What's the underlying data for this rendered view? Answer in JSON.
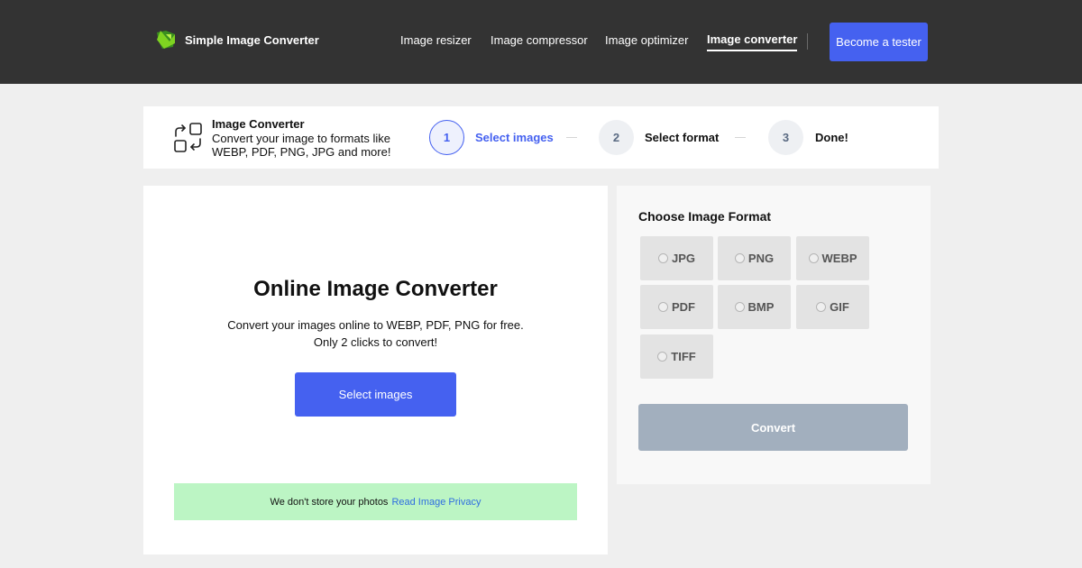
{
  "header": {
    "brand": "Simple Image Converter",
    "nav": [
      {
        "label": "Image resizer",
        "active": false
      },
      {
        "label": "Image compressor",
        "active": false
      },
      {
        "label": "Image optimizer",
        "active": false
      },
      {
        "label": "Image converter",
        "active": true
      }
    ],
    "cta_label": "Become a tester"
  },
  "steps_bar": {
    "title": "Image Converter",
    "description": "Convert your image to formats like WEBP, PDF, PNG, JPG and more!",
    "steps": [
      {
        "number": "1",
        "label": "Select images",
        "active": true
      },
      {
        "number": "2",
        "label": "Select format",
        "active": false
      },
      {
        "number": "3",
        "label": "Done!",
        "active": false
      }
    ]
  },
  "main": {
    "heading": "Online Image Converter",
    "desc_line1": "Convert your images online to WEBP, PDF, PNG for free.",
    "desc_line2": "Only 2 clicks to convert!",
    "select_button": "Select images",
    "privacy_text": "We don't store your photos",
    "privacy_link": "Read Image Privacy"
  },
  "format_panel": {
    "title": "Choose Image Format",
    "formats": [
      "JPG",
      "PNG",
      "WEBP",
      "PDF",
      "BMP",
      "GIF",
      "TIFF"
    ],
    "convert_label": "Convert"
  },
  "colors": {
    "header_bg": "#333333",
    "accent": "#4561f0",
    "privacy_bg": "#bcf5c4",
    "convert_disabled": "#a2afbe"
  }
}
